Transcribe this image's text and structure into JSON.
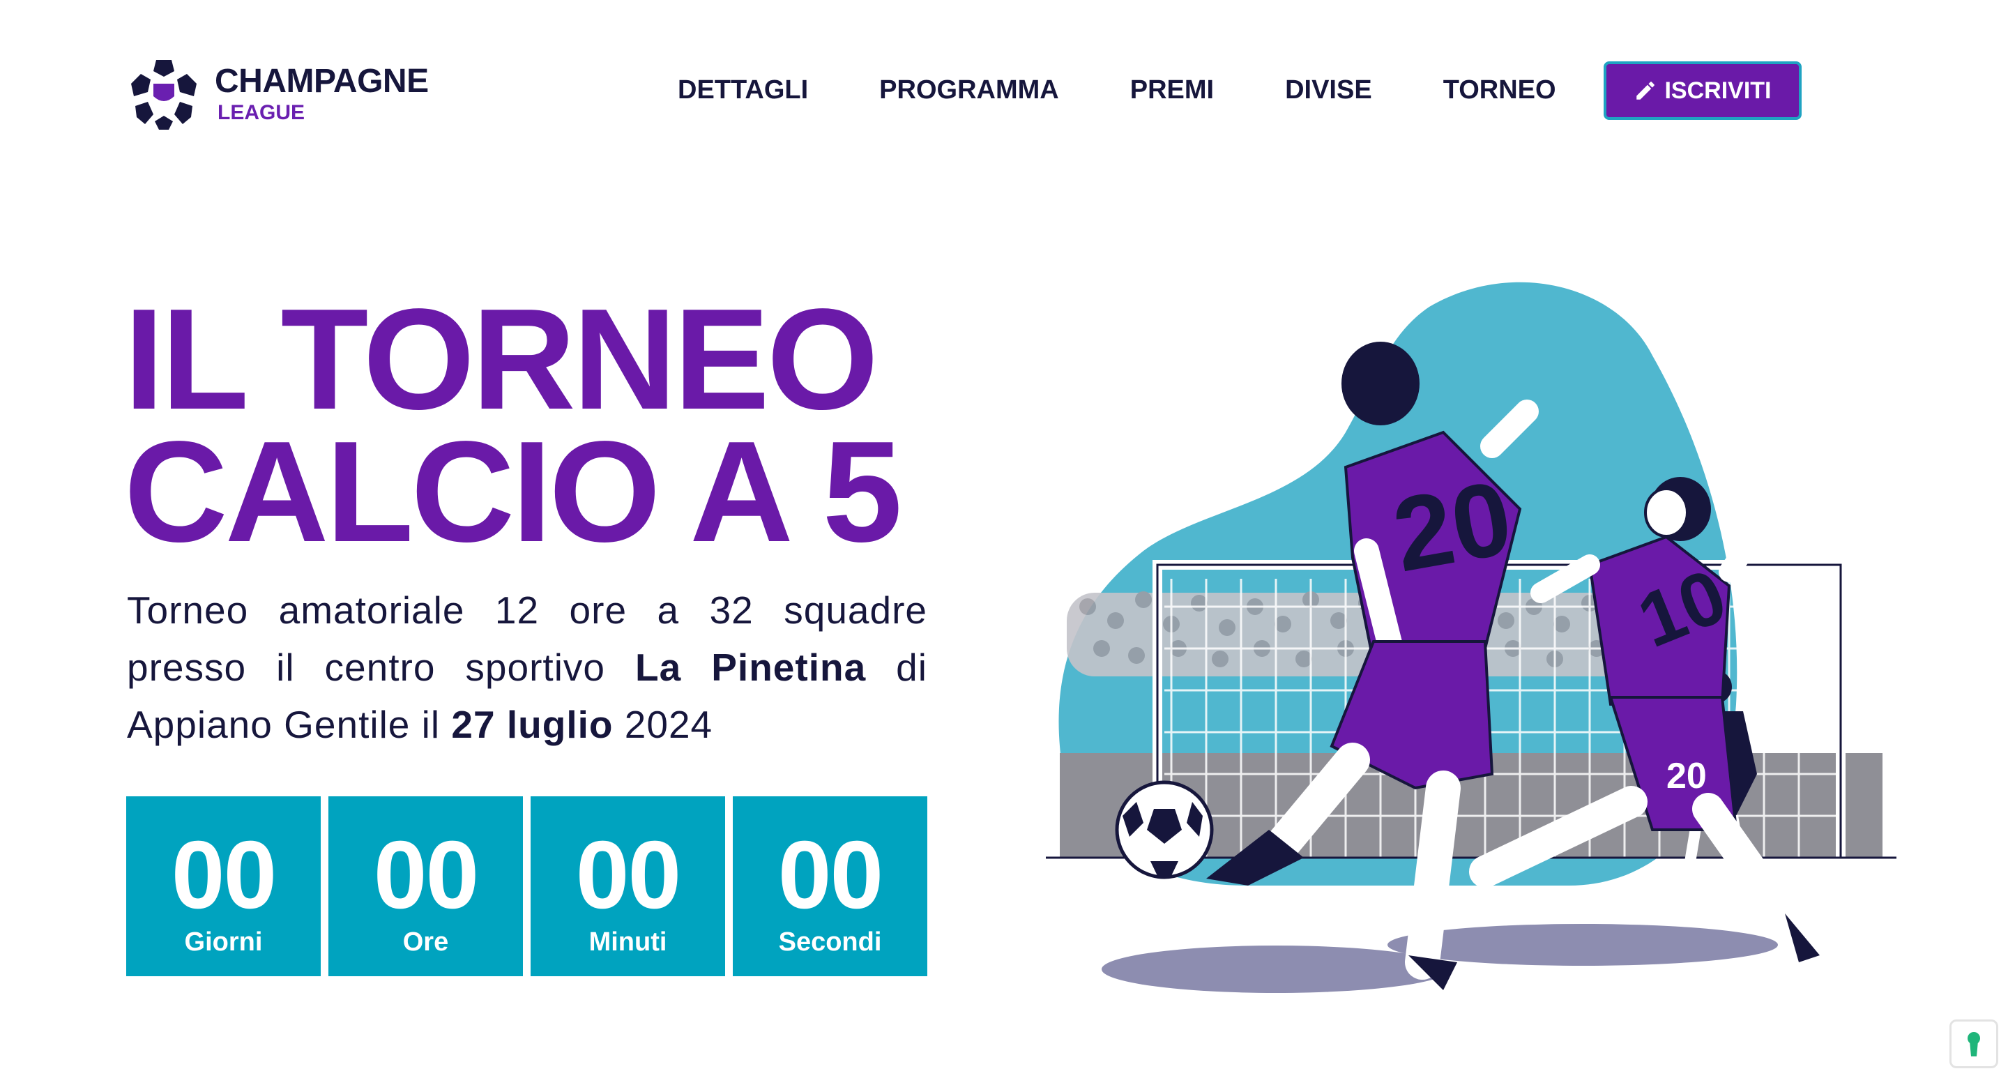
{
  "brand": {
    "line1": "CHAMPAGNE",
    "line2": "LEAGUE",
    "accent": "#6a1aa8",
    "teal": "#00a3bf",
    "dark": "#16163c"
  },
  "nav": {
    "items": [
      {
        "label": "DETTAGLI"
      },
      {
        "label": "PROGRAMMA"
      },
      {
        "label": "PREMI"
      },
      {
        "label": "DIVISE"
      },
      {
        "label": "TORNEO"
      }
    ],
    "cta_label": "ISCRIVITI",
    "cta_icon": "pencil-icon"
  },
  "hero": {
    "title_line1": "IL TORNEO",
    "title_line2": "CALCIO A 5",
    "desc_part1": "Torneo amatoriale 12 ore a 32 squadre presso il centro sportivo ",
    "desc_bold1": "La Pinetina",
    "desc_part2": " di Appiano Gentile il ",
    "desc_bold2": "27 luglio",
    "desc_part3": " 2024"
  },
  "countdown": [
    {
      "value": "00",
      "label": "Giorni"
    },
    {
      "value": "00",
      "label": "Ore"
    },
    {
      "value": "00",
      "label": "Minuti"
    },
    {
      "value": "00",
      "label": "Secondi"
    }
  ],
  "illustration": {
    "icon": "futsal-players-illustration",
    "number_a": "10",
    "number_b": "20",
    "number_c": "20"
  },
  "widget": {
    "icon": "keyhole-lock-icon"
  }
}
